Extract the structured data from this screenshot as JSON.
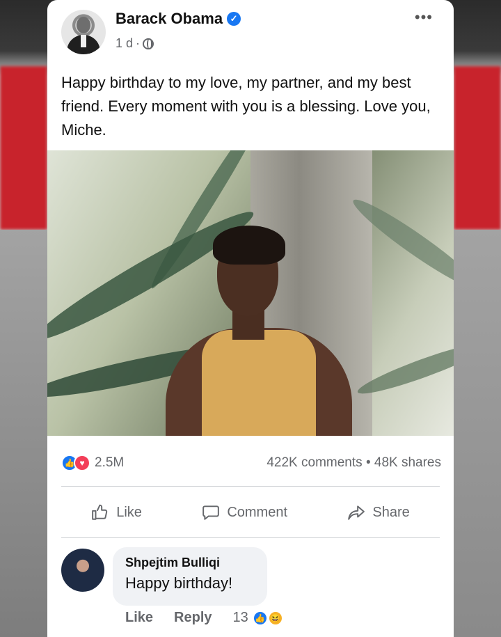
{
  "post": {
    "author": "Barack Obama",
    "time": "1 d",
    "separator": "·",
    "more_menu": "•••",
    "text": "Happy birthday to my love, my partner, and my best friend. Every moment with you is a blessing. Love you, Miche.",
    "reactions_count": "2.5M",
    "comments_count": "422K comments",
    "stats_separator": "•",
    "shares_count": "48K shares"
  },
  "actions": {
    "like": "Like",
    "comment": "Comment",
    "share": "Share"
  },
  "comment": {
    "author": "Shpejtim Bulliqi",
    "text": "Happy birthday!",
    "like": "Like",
    "reply": "Reply",
    "reaction_count": "13"
  },
  "icons": {
    "verified": "verified-badge-icon",
    "globe": "globe-icon",
    "like": "thumbs-up-icon",
    "comment": "speech-bubble-icon",
    "share": "share-arrow-icon",
    "love": "heart-icon",
    "haha": "laughing-face-icon"
  },
  "colors": {
    "facebook_blue": "#1877f2",
    "love_red": "#f33e58",
    "haha_yellow": "#f7b125",
    "secondary_text": "#65676b"
  }
}
